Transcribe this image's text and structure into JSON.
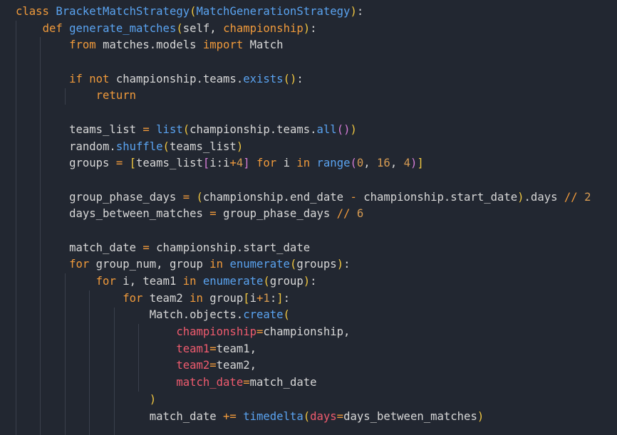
{
  "editor": {
    "background": "#222731",
    "colors": {
      "keyword": "#f09a3b",
      "function": "#5aa3f0",
      "identifier": "#d7d7d7",
      "number": "#d59a52",
      "kwarg": "#ef5b6e",
      "bracket_level1": "#f0c640",
      "bracket_level2": "#d67dd8",
      "bracket_level3": "#4fa6ee"
    },
    "lines": [
      [
        [
          "kw",
          "class "
        ],
        [
          "def",
          "BracketMatchStrategy"
        ],
        [
          "b1",
          "("
        ],
        [
          "def",
          "MatchGenerationStrategy"
        ],
        [
          "b1",
          ")"
        ],
        [
          "sym",
          ":"
        ]
      ],
      [
        [
          "id",
          "    "
        ],
        [
          "kw",
          "def "
        ],
        [
          "def",
          "generate_matches"
        ],
        [
          "b1",
          "("
        ],
        [
          "id",
          "self, "
        ],
        [
          "kw",
          "championship"
        ],
        [
          "b1",
          ")"
        ],
        [
          "sym",
          ":"
        ]
      ],
      [
        [
          "id",
          "        "
        ],
        [
          "kw",
          "from "
        ],
        [
          "id",
          "matches.models "
        ],
        [
          "kw",
          "import "
        ],
        [
          "id",
          "Match"
        ]
      ],
      [],
      [
        [
          "id",
          "        "
        ],
        [
          "kw",
          "if not "
        ],
        [
          "id",
          "championship.teams."
        ],
        [
          "call",
          "exists"
        ],
        [
          "b1",
          "()"
        ],
        [
          "sym",
          ":"
        ]
      ],
      [
        [
          "id",
          "            "
        ],
        [
          "kw",
          "return"
        ]
      ],
      [],
      [
        [
          "id",
          "        teams_list "
        ],
        [
          "op",
          "= "
        ],
        [
          "call",
          "list"
        ],
        [
          "b1",
          "("
        ],
        [
          "id",
          "championship.teams."
        ],
        [
          "call",
          "all"
        ],
        [
          "b2",
          "()"
        ],
        [
          "b1",
          ")"
        ]
      ],
      [
        [
          "id",
          "        random."
        ],
        [
          "call",
          "shuffle"
        ],
        [
          "b1",
          "("
        ],
        [
          "id",
          "teams_list"
        ],
        [
          "b1",
          ")"
        ]
      ],
      [
        [
          "id",
          "        groups "
        ],
        [
          "op",
          "= "
        ],
        [
          "b1",
          "["
        ],
        [
          "id",
          "teams_list"
        ],
        [
          "b2",
          "["
        ],
        [
          "id",
          "i:i"
        ],
        [
          "op",
          "+"
        ],
        [
          "num",
          "4"
        ],
        [
          "b2",
          "]"
        ],
        [
          "id",
          " "
        ],
        [
          "kw",
          "for "
        ],
        [
          "id",
          "i "
        ],
        [
          "kw",
          "in "
        ],
        [
          "call",
          "range"
        ],
        [
          "b2",
          "("
        ],
        [
          "num",
          "0"
        ],
        [
          "id",
          ", "
        ],
        [
          "num",
          "16"
        ],
        [
          "id",
          ", "
        ],
        [
          "num",
          "4"
        ],
        [
          "b2",
          ")"
        ],
        [
          "b1",
          "]"
        ]
      ],
      [],
      [
        [
          "id",
          "        group_phase_days "
        ],
        [
          "op",
          "= "
        ],
        [
          "b1",
          "("
        ],
        [
          "id",
          "championship.end_date "
        ],
        [
          "op",
          "- "
        ],
        [
          "id",
          "championship.start_date"
        ],
        [
          "b1",
          ")"
        ],
        [
          "id",
          ".days "
        ],
        [
          "op",
          "// "
        ],
        [
          "num",
          "2"
        ]
      ],
      [
        [
          "id",
          "        days_between_matches "
        ],
        [
          "op",
          "= "
        ],
        [
          "id",
          "group_phase_days "
        ],
        [
          "op",
          "// "
        ],
        [
          "num",
          "6"
        ]
      ],
      [],
      [
        [
          "id",
          "        match_date "
        ],
        [
          "op",
          "= "
        ],
        [
          "id",
          "championship.start_date"
        ]
      ],
      [
        [
          "id",
          "        "
        ],
        [
          "kw",
          "for "
        ],
        [
          "id",
          "group_num, group "
        ],
        [
          "kw",
          "in "
        ],
        [
          "call",
          "enumerate"
        ],
        [
          "b1",
          "("
        ],
        [
          "id",
          "groups"
        ],
        [
          "b1",
          ")"
        ],
        [
          "sym",
          ":"
        ]
      ],
      [
        [
          "id",
          "            "
        ],
        [
          "kw",
          "for "
        ],
        [
          "id",
          "i, team1 "
        ],
        [
          "kw",
          "in "
        ],
        [
          "call",
          "enumerate"
        ],
        [
          "b1",
          "("
        ],
        [
          "id",
          "group"
        ],
        [
          "b1",
          ")"
        ],
        [
          "sym",
          ":"
        ]
      ],
      [
        [
          "id",
          "                "
        ],
        [
          "kw",
          "for "
        ],
        [
          "id",
          "team2 "
        ],
        [
          "kw",
          "in "
        ],
        [
          "id",
          "group"
        ],
        [
          "b1",
          "["
        ],
        [
          "id",
          "i"
        ],
        [
          "op",
          "+"
        ],
        [
          "num",
          "1"
        ],
        [
          "id",
          ":"
        ],
        [
          "b1",
          "]"
        ],
        [
          "sym",
          ":"
        ]
      ],
      [
        [
          "id",
          "                    Match.objects."
        ],
        [
          "call",
          "create"
        ],
        [
          "b1",
          "("
        ]
      ],
      [
        [
          "id",
          "                        "
        ],
        [
          "kwarg",
          "championship"
        ],
        [
          "op",
          "="
        ],
        [
          "id",
          "championship,"
        ]
      ],
      [
        [
          "id",
          "                        "
        ],
        [
          "kwarg",
          "team1"
        ],
        [
          "op",
          "="
        ],
        [
          "id",
          "team1,"
        ]
      ],
      [
        [
          "id",
          "                        "
        ],
        [
          "kwarg",
          "team2"
        ],
        [
          "op",
          "="
        ],
        [
          "id",
          "team2,"
        ]
      ],
      [
        [
          "id",
          "                        "
        ],
        [
          "kwarg",
          "match_date"
        ],
        [
          "op",
          "="
        ],
        [
          "id",
          "match_date"
        ]
      ],
      [
        [
          "id",
          "                    "
        ],
        [
          "b1",
          ")"
        ]
      ],
      [
        [
          "id",
          "                    match_date "
        ],
        [
          "op",
          "+= "
        ],
        [
          "call",
          "timedelta"
        ],
        [
          "b1",
          "("
        ],
        [
          "kwarg",
          "days"
        ],
        [
          "op",
          "="
        ],
        [
          "id",
          "days_between_matches"
        ],
        [
          "b1",
          ")"
        ]
      ]
    ]
  }
}
